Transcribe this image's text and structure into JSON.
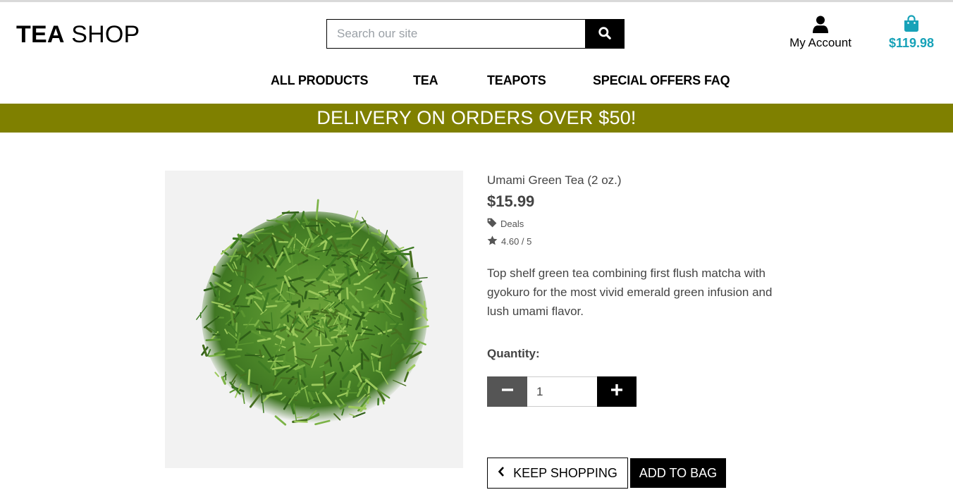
{
  "header": {
    "logo_bold": "TEA",
    "logo_light": "SHOP",
    "search_placeholder": "Search our site",
    "account_label": "My Account",
    "cart_total": "$119.98",
    "cart_color": "#17a2b8"
  },
  "nav": {
    "items": [
      "ALL PRODUCTS",
      "TEA",
      "TEAPOTS",
      "SPECIAL OFFERS",
      "FAQ"
    ]
  },
  "banner": {
    "text": "DELIVERY ON ORDERS OVER $50!",
    "color": "#7f8000"
  },
  "product": {
    "name": "Umami Green Tea (2 oz.)",
    "price": "$15.99",
    "category": "Deals",
    "rating": "4.60 / 5",
    "description": "Top shelf green tea combining first flush matcha with gyokuro for the most vivid emerald green infusion and lush umami flavor.",
    "quantity_label": "Quantity:",
    "quantity_value": "1"
  },
  "actions": {
    "keep_shopping": "KEEP SHOPPING",
    "add_to_bag": "ADD TO BAG"
  },
  "icons": {
    "search": "search-icon",
    "account": "user-icon",
    "cart": "shopping-bag-icon",
    "category": "tag-icon",
    "rating": "star-icon",
    "minus": "minus-icon",
    "plus": "plus-icon",
    "back": "chevron-left-icon"
  }
}
